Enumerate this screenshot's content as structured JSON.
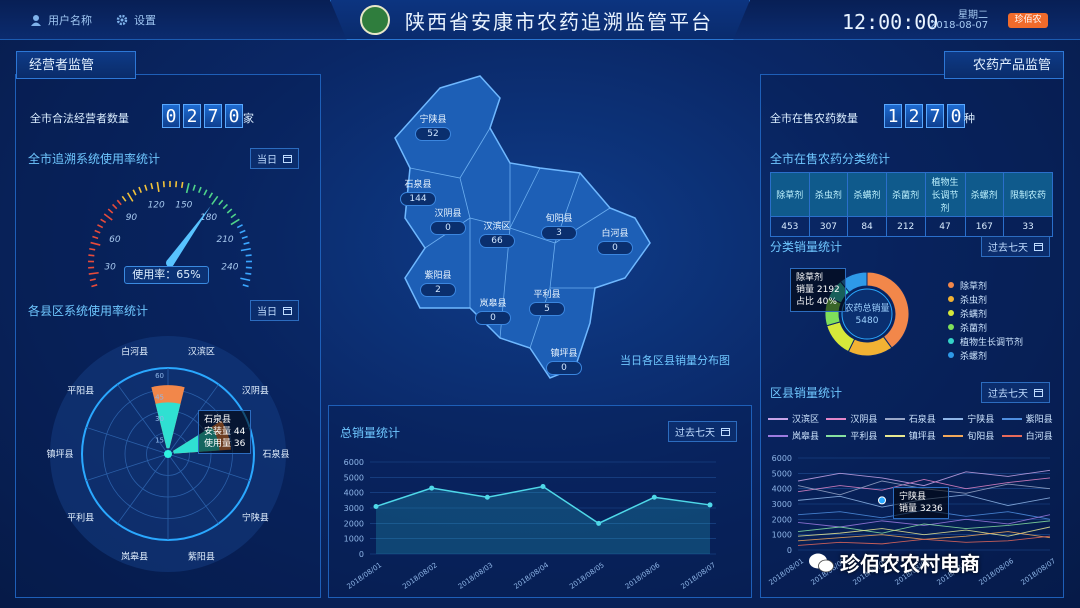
{
  "header": {
    "user_label": "用户名称",
    "settings_label": "设置",
    "title": "陕西省安康市农药追溯监管平台",
    "time": "12:00:00",
    "weekday": "星期二",
    "date": "2018-08-07",
    "brand": "珍佰农"
  },
  "left": {
    "tab": "经营者监管",
    "operator_count_label": "全市合法经营者数量",
    "operator_digits": [
      "0",
      "2",
      "7",
      "0"
    ],
    "operator_unit": "家",
    "usage_title": "全市追溯系统使用率统计",
    "date_btn": "当日",
    "gauge_ticks": [
      "0",
      "30",
      "60",
      "90",
      "120",
      "150",
      "180",
      "210",
      "240",
      "270"
    ],
    "gauge_value": 175,
    "usage_rate_label": "使用率：65%",
    "district_title": "各县区系统使用率统计",
    "district_date_btn": "当日",
    "polar_radial_ticks": [
      "60",
      "45",
      "30",
      "15"
    ],
    "polar_labels": [
      "汉滨区",
      "汉阴县",
      "石泉县",
      "宁陕县",
      "紫阳县",
      "岚皋县",
      "平利县",
      "镇坪县",
      "平阳县",
      "白河县"
    ],
    "polar_tooltip": {
      "name": "石泉县",
      "install": "安装量 44",
      "use": "使用量 36"
    }
  },
  "map": {
    "caption": "当日各区县销量分布图",
    "counties": [
      {
        "name": "宁陕县",
        "value": "52"
      },
      {
        "name": "石泉县",
        "value": "144"
      },
      {
        "name": "汉阴县",
        "value": "0"
      },
      {
        "name": "汉滨区",
        "value": "66"
      },
      {
        "name": "旬阳县",
        "value": "3"
      },
      {
        "name": "白河县",
        "value": "0"
      },
      {
        "name": "紫阳县",
        "value": "2"
      },
      {
        "name": "岚皋县",
        "value": "0"
      },
      {
        "name": "平利县",
        "value": "5"
      },
      {
        "name": "镇坪县",
        "value": "0"
      }
    ]
  },
  "total": {
    "title": "总销量统计",
    "date_btn": "过去七天"
  },
  "right": {
    "tab": "农药产品监管",
    "product_count_label": "全市在售农药数量",
    "product_digits": [
      "1",
      "2",
      "7",
      "0"
    ],
    "product_unit": "种",
    "category_title": "全市在售农药分类统计",
    "category_headers": [
      "除草剂",
      "杀虫剂",
      "杀螨剂",
      "杀菌剂",
      "植物生长调节剂",
      "杀螺剂",
      "限制农药"
    ],
    "category_values": [
      "453",
      "307",
      "84",
      "212",
      "47",
      "167",
      "33"
    ],
    "sales_title": "分类销量统计",
    "sales_date_btn": "过去七天",
    "donut_center_label": "农药总销量",
    "donut_center_value": "5480",
    "donut_tooltip": {
      "name": "除草剂",
      "sales": "销量 2192",
      "ratio": "占比 40%"
    },
    "donut_legend": [
      {
        "label": "除草剂",
        "color": "#f2874a"
      },
      {
        "label": "杀虫剂",
        "color": "#f2b233"
      },
      {
        "label": "杀螨剂",
        "color": "#d6e83a"
      },
      {
        "label": "杀菌剂",
        "color": "#7fe05a"
      },
      {
        "label": "植物生长调节剂",
        "color": "#35d3c8"
      },
      {
        "label": "杀螺剂",
        "color": "#2e9ae8"
      }
    ],
    "district_sales_title": "区县销量统计",
    "district_sales_date_btn": "过去七天",
    "district_lines": [
      {
        "label": "汉滨区",
        "color": "#c7a4e8"
      },
      {
        "label": "汉阴县",
        "color": "#e386c8"
      },
      {
        "label": "石泉县",
        "color": "#9aa8c8"
      },
      {
        "label": "宁陕县",
        "color": "#8fb6e8"
      },
      {
        "label": "紫阳县",
        "color": "#4f8fe0"
      },
      {
        "label": "岚皋县",
        "color": "#9c7be0"
      },
      {
        "label": "平利县",
        "color": "#86e0a0"
      },
      {
        "label": "镇坪县",
        "color": "#e8e890"
      },
      {
        "label": "旬阳县",
        "color": "#f2a85a"
      },
      {
        "label": "白河县",
        "color": "#e86a5a"
      }
    ],
    "district_tooltip": {
      "name": "宁陕县",
      "sales": "销量  3236"
    }
  },
  "watermark": "珍佰农农村电商",
  "chart_data": [
    {
      "type": "line",
      "title": "总销量统计",
      "x": [
        "2018/08/01",
        "2018/08/02",
        "2018/08/03",
        "2018/08/04",
        "2018/08/05",
        "2018/08/06",
        "2018/08/07"
      ],
      "values": [
        3100,
        4300,
        3700,
        4400,
        2000,
        3700,
        3200
      ],
      "ylim": [
        0,
        6000
      ],
      "yticks": [
        "0",
        "1000",
        "2000",
        "3000",
        "4000",
        "5000",
        "6000"
      ]
    },
    {
      "type": "pie",
      "title": "分类销量统计",
      "labels": [
        "除草剂",
        "杀虫剂",
        "杀螨剂",
        "杀菌剂",
        "植物生长调节剂",
        "杀螺剂"
      ],
      "values": [
        2192,
        950,
        720,
        600,
        420,
        598
      ]
    },
    {
      "type": "line",
      "title": "区县销量统计",
      "x": [
        "2018/08/01",
        "2018/08/02",
        "2018/08/03",
        "2018/08/04",
        "2018/08/05",
        "2018/08/06",
        "2018/08/07"
      ],
      "ylim": [
        0,
        6000
      ],
      "yticks": [
        "0",
        "1000",
        "2000",
        "3000",
        "4000",
        "5000",
        "6000"
      ],
      "series": [
        {
          "name": "汉滨区",
          "values": [
            4500,
            5000,
            4700,
            4200,
            5100,
            4800,
            5200
          ]
        },
        {
          "name": "汉阴县",
          "values": [
            3800,
            4200,
            3900,
            4600,
            4000,
            4400,
            4700
          ]
        },
        {
          "name": "石泉县",
          "values": [
            4200,
            3600,
            4500,
            4000,
            3700,
            4300,
            4000
          ]
        },
        {
          "name": "宁陕县",
          "values": [
            3236,
            3500,
            2800,
            3300,
            3600,
            2900,
            3400
          ]
        },
        {
          "name": "紫阳县",
          "values": [
            2300,
            2500,
            2100,
            2600,
            2200,
            2500,
            2000
          ]
        },
        {
          "name": "岚皋县",
          "values": [
            1800,
            1500,
            1900,
            1600,
            2000,
            1700,
            2300
          ]
        },
        {
          "name": "平利县",
          "values": [
            1200,
            1500,
            1100,
            1700,
            1400,
            1600,
            1900
          ]
        },
        {
          "name": "镇坪县",
          "values": [
            900,
            1100,
            1400,
            1000,
            1300,
            900,
            1500
          ]
        },
        {
          "name": "旬阳县",
          "values": [
            600,
            800,
            1000,
            700,
            900,
            1200,
            800
          ]
        },
        {
          "name": "白河县",
          "values": [
            300,
            500,
            400,
            700,
            500,
            600,
            900
          ]
        }
      ]
    },
    {
      "type": "bar",
      "title": "各县区系统使用率统计",
      "categories": [
        "汉滨区",
        "汉阴县",
        "石泉县",
        "宁陕县",
        "紫阳县",
        "岚皋县",
        "平利县",
        "镇坪县",
        "平阳县",
        "白河县"
      ],
      "series": [
        {
          "name": "安装量",
          "values": [
            48,
            0,
            44,
            0,
            0,
            0,
            0,
            0,
            0,
            0
          ]
        },
        {
          "name": "使用量",
          "values": [
            36,
            0,
            36,
            0,
            0,
            0,
            0,
            0,
            0,
            0
          ]
        }
      ],
      "ylim": [
        0,
        60
      ]
    }
  ]
}
